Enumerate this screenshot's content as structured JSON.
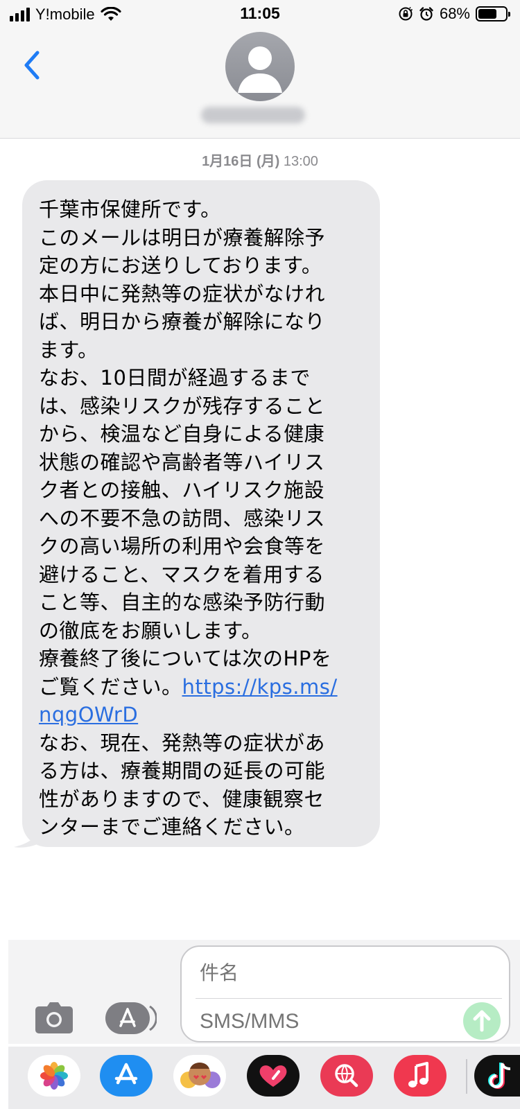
{
  "status_bar": {
    "carrier": "Y!mobile",
    "time": "11:05",
    "battery_percent": "68%",
    "battery_level": 0.68,
    "icons": [
      "signal-icon",
      "wifi-icon",
      "orientation-lock-icon",
      "alarm-icon",
      "battery-icon"
    ]
  },
  "header": {
    "back_icon": "chevron-left-icon",
    "avatar_icon": "person-silhouette-icon",
    "contact_name": "●●●●●●●●●"
  },
  "conversation": {
    "timestamp_date": "1月16日 (月)",
    "timestamp_time": "13:00",
    "message": {
      "lines": [
        "千葉市保健所です。",
        "このメールは明日が療養解除予",
        "定の方にお送りしております。",
        "本日中に発熱等の症状がなけれ",
        "ば、明日から療養が解除になり",
        "ます。",
        "なお、10日間が経過するまで",
        "は、感染リスクが残存すること",
        "から、検温など自身による健康",
        "状態の確認や高齢者等ハイリス",
        "ク者との接触、ハイリスク施設",
        "への不要不急の訪問、感染リス",
        "クの高い場所の利用や会食等を",
        "避けること、マスクを着用する",
        "こと等、自主的な感染予防行動",
        "の徹底をお願いします。",
        "療養終了後については次のHPを"
      ],
      "link_line_prefix": "ご覧ください。",
      "link_part1": "https://kps.ms/",
      "link_part2": "nqgOWrD",
      "lines_after": [
        "なお、現在、発熱等の症状があ",
        "る方は、療養期間の延長の可能",
        "性がありますので、健康観察セ",
        "ンターまでご連絡ください。"
      ]
    }
  },
  "compose": {
    "subject_placeholder": "件名",
    "body_placeholder": "SMS/MMS",
    "camera_icon": "camera-icon",
    "apps_icon": "app-store-icon",
    "send_icon": "arrow-up-icon"
  },
  "app_drawer": {
    "apps": [
      "photos-icon",
      "app-store-icon",
      "memoji-icon",
      "digital-touch-icon",
      "web-search-icon",
      "music-icon",
      "tiktok-icon"
    ]
  },
  "colors": {
    "link": "#2a6ee0",
    "bubble": "#e9e9eb",
    "ios_blue": "#1f7cf5",
    "send_button": "#b6ecc4"
  }
}
